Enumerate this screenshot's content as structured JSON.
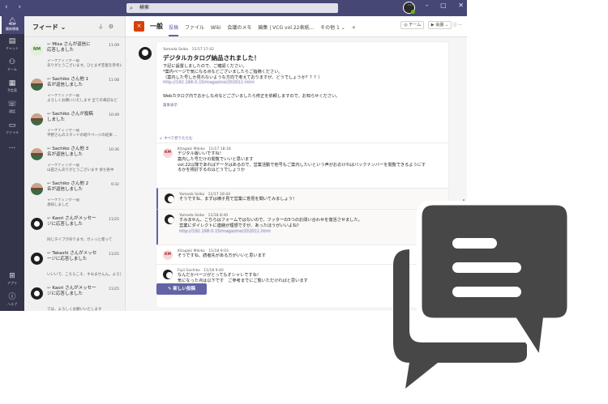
{
  "titlebar": {
    "search_placeholder": "検索"
  },
  "rail": {
    "items": [
      {
        "label": "最新情報",
        "icon": "bell-icon"
      },
      {
        "label": "チャット",
        "icon": "chat-icon"
      },
      {
        "label": "チーム",
        "icon": "teams-icon"
      },
      {
        "label": "予定表",
        "icon": "calendar-icon"
      },
      {
        "label": "通話",
        "icon": "phone-icon"
      },
      {
        "label": "ファイル",
        "icon": "file-icon"
      },
      {
        "label": "...",
        "icon": "more-icon"
      },
      {
        "label": "アプリ",
        "icon": "apps-icon"
      },
      {
        "label": "ヘルプ",
        "icon": "help-icon"
      }
    ]
  },
  "feed": {
    "title": "フィード",
    "items": [
      {
        "line1": "Misa さんが返信に",
        "line2": "応答しました",
        "sub1": "マーケティングー般",
        "sub2": "ありがとうございます。ひとまず定着を参考に",
        "time": "11:09",
        "avatar": "NM"
      },
      {
        "line1": "Sachiko さん他 1",
        "line2": "名が返信しました",
        "sub1": "マーケティングー般",
        "sub2": "よろしくお願いいたします 全ての来訪など",
        "time": "11:08",
        "avatar": ""
      },
      {
        "line1": "Sachiko さんが投稿",
        "line2": "しました",
        "sub1": "マーケティングー般",
        "sub2": "平野さんのスタンドの紹介ページの結果 ...",
        "time": "10:49",
        "avatar": ""
      },
      {
        "line1": "Sachiko さん他 3",
        "line2": "名が返信しました",
        "sub1": "マーケティングー般",
        "sub2": "山田さんありがとうございます 承ち各中",
        "time": "10:36",
        "avatar": ""
      },
      {
        "line1": "Sachiko さん他 2",
        "line2": "名が返信しました",
        "sub1": "マーケティングー般",
        "sub2": "承知しました",
        "time": "9:32",
        "avatar": ""
      },
      {
        "line1": "Kaori さんがメッセー",
        "line2": "ジに応答しました",
        "sub1": "",
        "sub2": "同じタイプがあります。ガッっと使って",
        "time": "11/25",
        "avatar": ""
      },
      {
        "line1": "Takashi さんがメッセ",
        "line2": "ージに応答しました",
        "sub1": "",
        "sub2": "いいいで、こちらこそ、すみませんん。よろしく",
        "time": "11/25",
        "avatar": ""
      },
      {
        "line1": "Kaori さんがメッセー",
        "line2": "ジに応答しました",
        "sub1": "",
        "sub2": "では、よろしくお願いいたします",
        "time": "11/25",
        "avatar": ""
      },
      {
        "line1": "Sachiko さんが返信",
        "line2": "に応答しました",
        "sub1": "",
        "sub2": "",
        "time": "11/24",
        "avatar": ""
      }
    ]
  },
  "channel": {
    "icon_letter": "×",
    "name": "一般",
    "tabs": [
      "投稿",
      "ファイル",
      "Wiki",
      "会議のメモ",
      "編集 | VCG vol.22表紙...",
      "その他 1 ⌄",
      "+"
    ],
    "team_label": "チーム",
    "meet_label": "会議",
    "more": "···"
  },
  "post": {
    "author": "Yamada Seiko",
    "time": "11/17 17:42",
    "title": "デジタルカタログ納品されました！",
    "lines": [
      "下記に設置しましたので、ご確認ください。",
      "*案内ページで気になる点などございましたらご指摘ください。",
      "（案内した号しか見れないような方向で考えておりますが、どうでしょうか？？？）"
    ],
    "link": "http://192.168.0.15/magazine/202011.html",
    "footer": "Webカタログ内でおかしな点などございましたら修正を依頼しますので、お知らせください。",
    "show_more": "篇果表示",
    "collapse": "すべて折りたたむ"
  },
  "replies": [
    {
      "author": "Kitagaki Mikiko",
      "time": "11/17 18:18",
      "avatar": "KM",
      "lines": [
        "デジタル版いいですね！",
        "案内した号だけの閲覧でいいと思います",
        "vol.22以降であればデータはあるので、営業活動で他号もご案内したいという声がおおければバックナンバーを閲覧できるようにす",
        "るかを検討するのはどうでしょうか"
      ],
      "reaction": ""
    },
    {
      "author": "Yamada Seiko",
      "time": "11/17 18:44",
      "avatar": "",
      "lines": [
        "そうですね、まずは様子見で営業に意見を聞いてみましょう！"
      ],
      "reaction": ""
    },
    {
      "author": "Yamada Seiko",
      "time": "11/18 8:40",
      "avatar": "",
      "lines": [
        "すみません、こちらはフォームではないので、フッターの5つのお問い合わせを復活させました。",
        "営業にダイレクトに連絡が理想ですが、あったほうがいいよね？"
      ],
      "link": "http://192.168.0.15/magazine/202011.html",
      "reaction": "1"
    },
    {
      "author": "Kitagaki Mikiko",
      "time": "11/18 9:03",
      "avatar": "KM",
      "lines": [
        "そうですね、読者先がある方がいいと思います"
      ],
      "reaction": ""
    },
    {
      "author": "Fujii Sachiko",
      "time": "11/18 9:40",
      "avatar": "",
      "lines": [
        "なんだかページがとってもオシャレですね！",
        "気になった点は以下です　ご参考までにご覧いただければと思います"
      ],
      "reaction": ""
    }
  ],
  "new_post_label": "新しい投稿",
  "colors": {
    "brand": "#6264a7",
    "titlebar": "#464775",
    "rail": "#33344a",
    "icon": "#474747"
  }
}
